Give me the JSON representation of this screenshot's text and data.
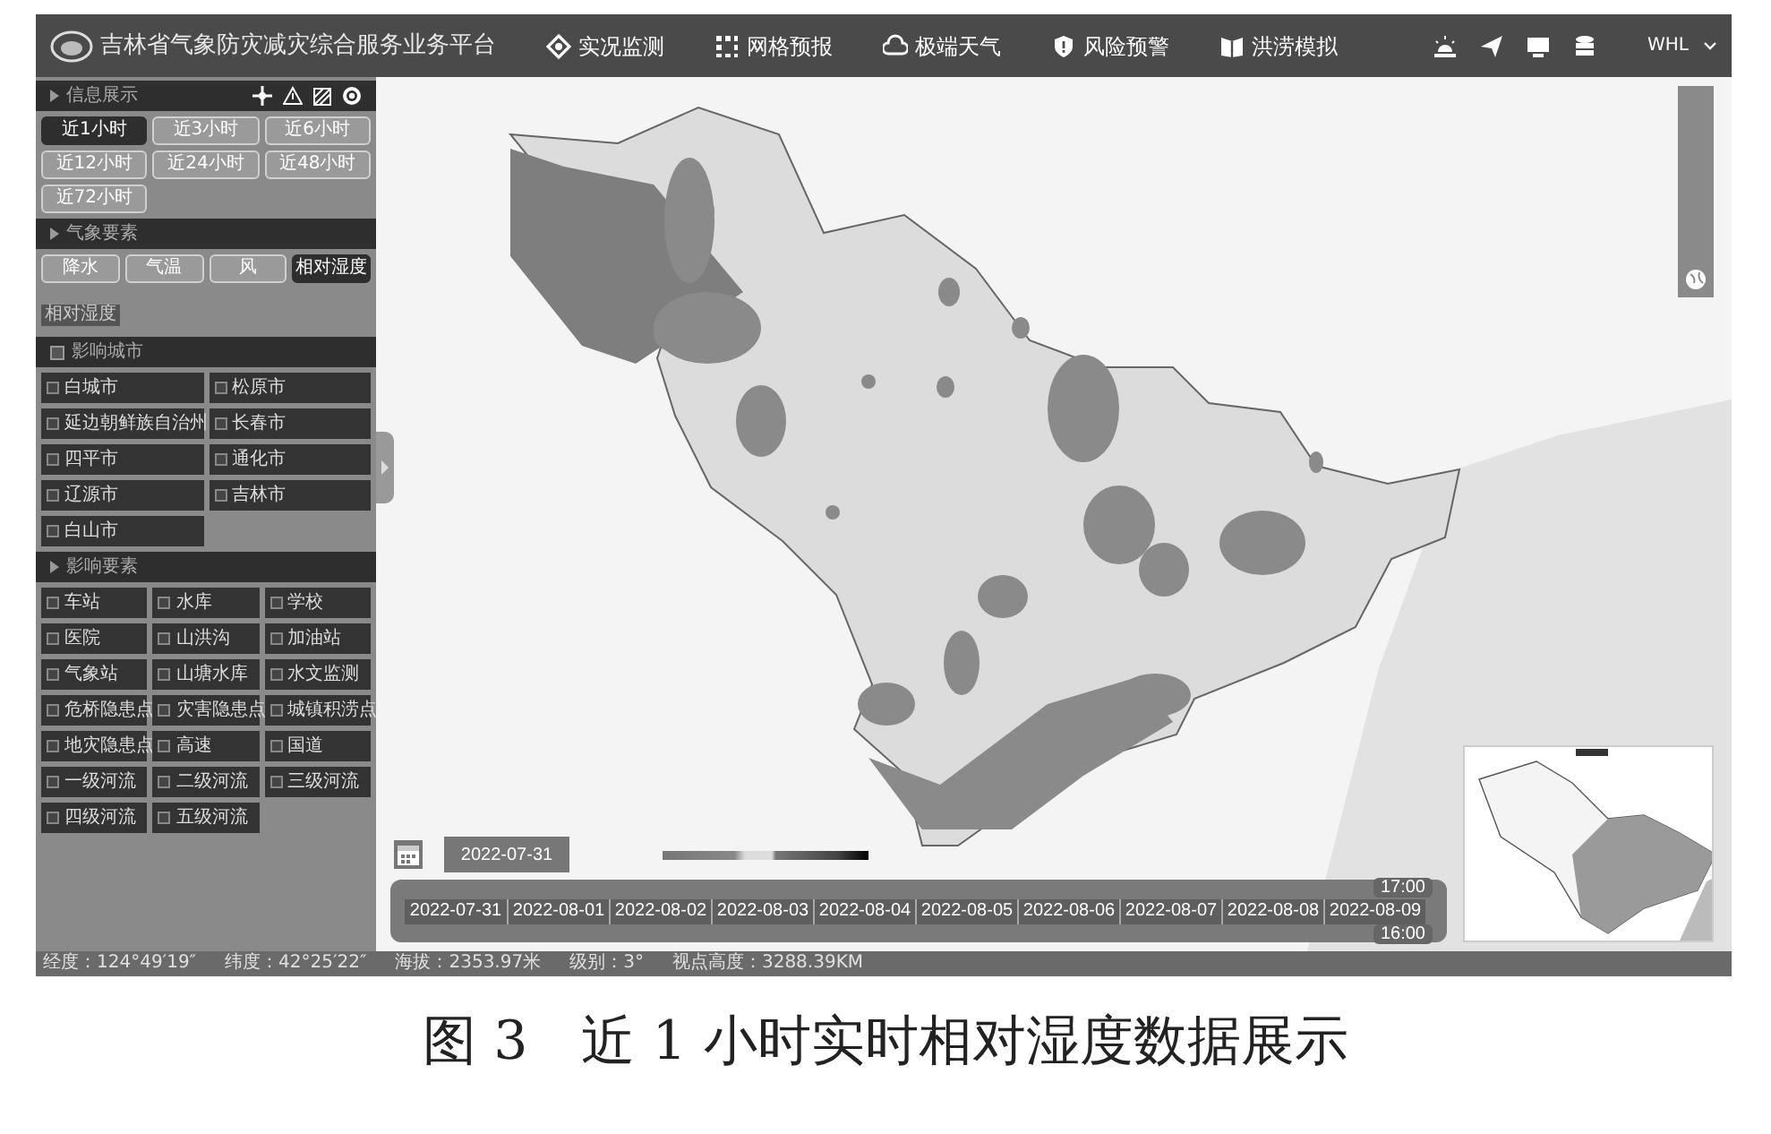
{
  "header": {
    "title": "吉林省气象防灾减灾综合服务业务平台",
    "nav": [
      {
        "label": "实况监测",
        "kind": "monitor"
      },
      {
        "label": "网格预报",
        "kind": "grid"
      },
      {
        "label": "极端天气",
        "kind": "cloud"
      },
      {
        "label": "风险预警",
        "kind": "shield"
      },
      {
        "label": "洪涝模拟",
        "kind": "flood"
      }
    ],
    "user": "WHL"
  },
  "sidebar": {
    "sections": [
      {
        "title": "信息展示",
        "kind": "buttons",
        "items": [
          {
            "label": "近1小时",
            "selected": true
          },
          {
            "label": "近3小时",
            "selected": false
          },
          {
            "label": "近6小时",
            "selected": false
          },
          {
            "label": "近12小时",
            "selected": false
          },
          {
            "label": "近24小时",
            "selected": false
          },
          {
            "label": "近48小时",
            "selected": false
          },
          {
            "label": "近72小时",
            "selected": false
          }
        ]
      },
      {
        "title": "气象要素",
        "kind": "buttons",
        "items": [
          {
            "label": "降水",
            "selected": false
          },
          {
            "label": "气温",
            "selected": false
          },
          {
            "label": "风",
            "selected": false
          },
          {
            "label": "相对湿度",
            "selected": true
          }
        ],
        "tag": "相对湿度"
      },
      {
        "title": "影响城市",
        "kind": "checklist",
        "checked": false,
        "items": [
          {
            "label": "白城市",
            "checked": false
          },
          {
            "label": "松原市",
            "checked": false
          },
          {
            "label": "延边朝鲜族自治州",
            "checked": false
          },
          {
            "label": "长春市",
            "checked": false
          },
          {
            "label": "四平市",
            "checked": false
          },
          {
            "label": "通化市",
            "checked": false
          },
          {
            "label": "辽源市",
            "checked": false
          },
          {
            "label": "吉林市",
            "checked": false
          },
          {
            "label": "白山市",
            "checked": false
          }
        ]
      },
      {
        "title": "影响要素",
        "kind": "checklist",
        "items": [
          {
            "label": "车站",
            "checked": false
          },
          {
            "label": "水库",
            "checked": false
          },
          {
            "label": "学校",
            "checked": false
          },
          {
            "label": "医院",
            "checked": false
          },
          {
            "label": "山洪沟",
            "checked": false
          },
          {
            "label": "加油站",
            "checked": false
          },
          {
            "label": "气象站",
            "checked": false
          },
          {
            "label": "山塘水库",
            "checked": false
          },
          {
            "label": "水文监测",
            "checked": false
          },
          {
            "label": "危桥隐患点",
            "checked": false
          },
          {
            "label": "灾害隐患点",
            "checked": false
          },
          {
            "label": "城镇积涝点",
            "checked": false
          },
          {
            "label": "地灾隐患点",
            "checked": false
          },
          {
            "label": "高速",
            "checked": false
          },
          {
            "label": "国道",
            "checked": false
          },
          {
            "label": "一级河流",
            "checked": false
          },
          {
            "label": "二级河流",
            "checked": false
          },
          {
            "label": "三级河流",
            "checked": false
          },
          {
            "label": "四级河流",
            "checked": false
          },
          {
            "label": "五级河流",
            "checked": false
          }
        ]
      }
    ]
  },
  "date_field": {
    "value": "2022-07-31"
  },
  "timeline": {
    "top_time": "17:00",
    "bottom_time": "16:00",
    "dates": [
      "2022-07-31",
      "2022-08-01",
      "2022-08-02",
      "2022-08-03",
      "2022-08-04",
      "2022-08-05",
      "2022-08-06",
      "2022-08-07",
      "2022-08-08",
      "2022-08-09"
    ]
  },
  "status_bar": [
    "经度：124°49′19″",
    "纬度：42°25′22″",
    "海拔：2353.97米",
    "级别：3°",
    "视点高度：3288.39KM"
  ],
  "caption": "图 3　近 1 小时实时相对湿度数据展示"
}
